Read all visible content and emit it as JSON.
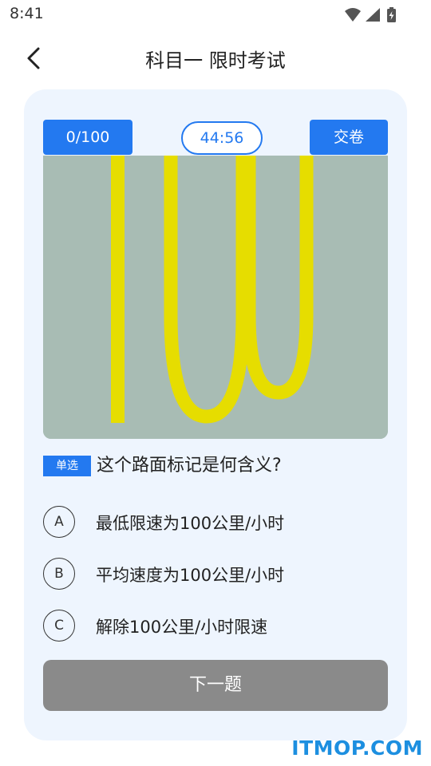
{
  "status_bar": {
    "time": "8:41",
    "icons": [
      "wifi-icon",
      "signal-icon",
      "battery-charging-icon"
    ]
  },
  "header": {
    "back_icon": "chevron-left-icon",
    "title": "科目一 限时考试"
  },
  "exam": {
    "progress_text": "0/100",
    "timer_text": "44:56",
    "submit_label": "交卷"
  },
  "question": {
    "image_content": "100",
    "image_colors": {
      "road": "#a8bcb4",
      "marking": "#e6dd00"
    },
    "type_label": "单选",
    "text": "这个路面标记是何含义?",
    "options": [
      {
        "letter": "A",
        "text": "最低限速为100公里/小时"
      },
      {
        "letter": "B",
        "text": "平均速度为100公里/小时"
      },
      {
        "letter": "C",
        "text": "解除100公里/小时限速"
      }
    ]
  },
  "next_label": "下一题",
  "watermark": "ITMOP.COM",
  "colors": {
    "accent": "#2379f0",
    "card_bg": "#eef5fe",
    "button_disabled": "#8a8a8a"
  }
}
